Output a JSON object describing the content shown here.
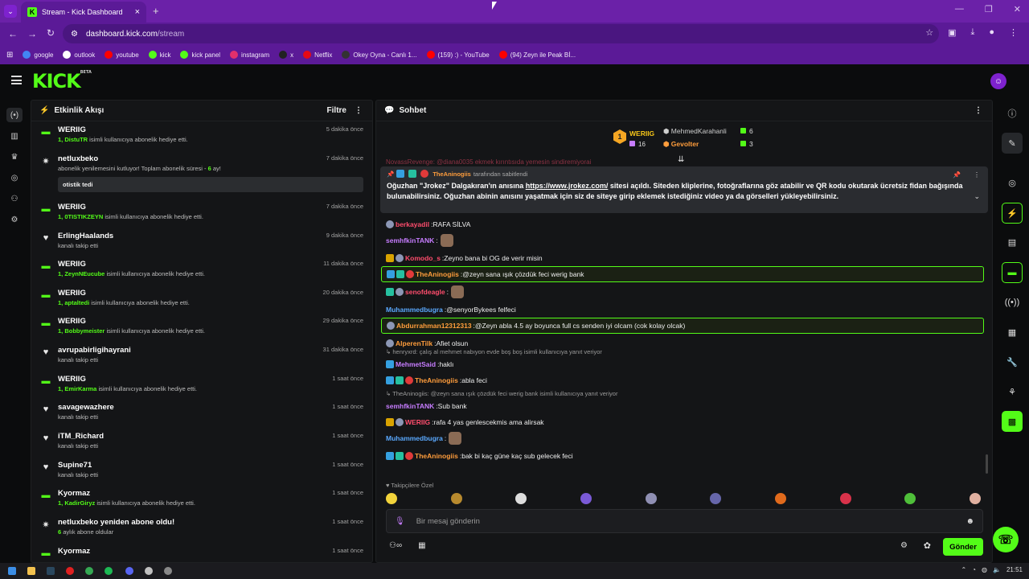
{
  "browser": {
    "tab_title": "Stream - Kick Dashboard",
    "url_host": "dashboard.kick.com",
    "url_path": "/stream",
    "bookmarks": [
      {
        "label": "google",
        "color": "#4285f4"
      },
      {
        "label": "outlook",
        "color": "#ffffff"
      },
      {
        "label": "youtube",
        "color": "#ff0000"
      },
      {
        "label": "kick",
        "color": "#53fc18"
      },
      {
        "label": "kick panel",
        "color": "#53fc18"
      },
      {
        "label": "instagram",
        "color": "#e1306c"
      },
      {
        "label": "x",
        "color": "#222222"
      },
      {
        "label": "Netflix",
        "color": "#e50914"
      },
      {
        "label": "Okey Oyna - Canlı 1...",
        "color": "#333333"
      },
      {
        "label": "(159) :) - YouTube",
        "color": "#ff0000"
      },
      {
        "label": "(94) Zeyn ile Peak Bİ...",
        "color": "#ff0000"
      }
    ]
  },
  "kick": {
    "logo": "KICK",
    "logo_sup": "BETA"
  },
  "activity": {
    "title": "Etkinlik Akışı",
    "filter_label": "Filtre",
    "items": [
      {
        "icon": "gift",
        "name": "WERIIG",
        "time": "5 dakika önce",
        "hl": "1, DistuTR",
        "rest": " isimli kullanıcıya abonelik hediye etti."
      },
      {
        "icon": "star",
        "name": "netluxbeko",
        "time": "7 dakika önce",
        "hl": "",
        "rest": "abonelik yenilemesini kutluyor! Toplam abonelik süresi - ",
        "hl2": "6",
        "rest2": " ay!",
        "quote": "otistik tedi"
      },
      {
        "icon": "gift",
        "name": "WERIIG",
        "time": "7 dakika önce",
        "hl": "1, 0TISTIKZEYN",
        "rest": " isimli kullanıcıya abonelik hediye etti."
      },
      {
        "icon": "heart",
        "name": "ErlingHaalands",
        "time": "9 dakika önce",
        "hl": "",
        "rest": "kanalı takip etti"
      },
      {
        "icon": "gift",
        "name": "WERIIG",
        "time": "11 dakika önce",
        "hl": "1, ZeynNEucube",
        "rest": " isimli kullanıcıya abonelik hediye etti."
      },
      {
        "icon": "gift",
        "name": "WERIIG",
        "time": "20 dakika önce",
        "hl": "1, aptaltedi",
        "rest": " isimli kullanıcıya abonelik hediye etti."
      },
      {
        "icon": "gift",
        "name": "WERIIG",
        "time": "29 dakika önce",
        "hl": "1, Bobbymeister",
        "rest": " isimli kullanıcıya abonelik hediye etti."
      },
      {
        "icon": "heart",
        "name": "avrupabirligihayrani",
        "time": "31 dakika önce",
        "hl": "",
        "rest": "kanalı takip etti"
      },
      {
        "icon": "gift",
        "name": "WERIIG",
        "time": "1 saat önce",
        "hl": "1, EmirKarma",
        "rest": " isimli kullanıcıya abonelik hediye etti."
      },
      {
        "icon": "heart",
        "name": "savagewazhere",
        "time": "1 saat önce",
        "hl": "",
        "rest": "kanalı takip etti"
      },
      {
        "icon": "heart",
        "name": "iTM_Richard",
        "time": "1 saat önce",
        "hl": "",
        "rest": "kanalı takip etti"
      },
      {
        "icon": "heart",
        "name": "Supine71",
        "time": "1 saat önce",
        "hl": "",
        "rest": "kanalı takip etti"
      },
      {
        "icon": "gift",
        "name": "Kyormaz",
        "time": "1 saat önce",
        "hl": "1, KadirGiryz",
        "rest": " isimli kullanıcıya abonelik hediye etti."
      },
      {
        "icon": "star",
        "name": "netluxbeko yeniden abone oldu!",
        "time": "1 saat önce",
        "hl": "6",
        "rest": " aylık abone oldular"
      },
      {
        "icon": "gift",
        "name": "Kyormaz",
        "time": "1 saat önce",
        "hl": "",
        "rest": ""
      }
    ]
  },
  "chat": {
    "title": "Sohbet",
    "top_gifter": {
      "badge": "1",
      "name": "WERIIG",
      "count": "16"
    },
    "leaders": [
      {
        "name": "MehmedKarahanli",
        "count": "6",
        "color": "#cfcfcf"
      },
      {
        "name": "Gevolter",
        "count": "3",
        "color": "#ff9d3c"
      }
    ],
    "pinned": {
      "by": "TheAninogiis",
      "suffix": "tarafından sabitlendi",
      "text_a": "Oğuzhan \"Jrokez\" Dalgakıran'ın anısına ",
      "link": "https://www.jrokez.com/",
      "text_b": " sitesi açıldı. Siteden kliplerine, fotoğraflarına göz atabilir ve QR kodu okutarak ücretsiz fidan bağışında bulunabilirsiniz. Oğuzhan abinin anısını yaşatmak için siz de siteye girip eklemek istediğiniz video ya da görselleri yükleyebilirsiniz."
    },
    "partial_msg": "NovassRevenge: @diana0035 ekmek kırıntısıda yemesin sindiremiyorai",
    "messages": [
      {
        "user": "berkayadil",
        "color": "#ff4d6d",
        "text": " RAFA SİLVA",
        "badges": [
          "gray"
        ],
        "hl": false
      },
      {
        "user": "semhfkinTANK",
        "color": "#c77dff",
        "text": " ",
        "badges": [],
        "hl": false,
        "emote": true
      },
      {
        "user": "Komodo_s",
        "color": "#ff4d6d",
        "text": " Zeyno bana bi OG de verir misin",
        "badges": [
          "gold",
          "gray"
        ],
        "hl": false
      },
      {
        "user": "TheAninogiis",
        "color": "#ff9d3c",
        "text": " @zeyn sana ışık çözdük feci werig bank",
        "badges": [
          "blue",
          "teal",
          "red"
        ],
        "hl": true
      },
      {
        "user": "senofdeagle",
        "color": "#ff4d6d",
        "text": " ",
        "badges": [
          "teal",
          "gray"
        ],
        "hl": false,
        "emote": true
      },
      {
        "user": "Muhammedbugra",
        "color": "#5aa9ff",
        "text": " @senyorBykees felfeci",
        "badges": [],
        "hl": false
      },
      {
        "user": "Abdurrahman12312313",
        "color": "#ff9d3c",
        "text": " @Zeyn abla 4.5 ay boyunca full cs senden iyi olcam (cok kolay olcak)",
        "badges": [
          "gray"
        ],
        "hl": true
      },
      {
        "user": "AlperenTilk",
        "color": "#ff9d3c",
        "text": " Afiet olsun",
        "badges": [
          "gray"
        ],
        "hl": false
      },
      {
        "user": "MehmetSaid",
        "color": "#c77dff",
        "text": " haklı",
        "badges": [
          "blue"
        ],
        "hl": false,
        "reply": "henryxrd: çalış al mehmet nabıyon evde boş boş isimli kullanıcıya yanıt veriyor"
      },
      {
        "user": "TheAninogiis",
        "color": "#ff9d3c",
        "text": " abla feci",
        "badges": [
          "blue",
          "teal",
          "red"
        ],
        "hl": false
      },
      {
        "user": "semhfkinTANK",
        "color": "#c77dff",
        "text": " Sub bank",
        "badges": [],
        "hl": false,
        "reply": "TheAninogiis: @zeyn sana ışık çözdük feci werig bank isimli kullanıcıya yanıt veriyor"
      },
      {
        "user": "WERIIG",
        "color": "#ff4d6d",
        "text": " rafa 4 yas genlescekmis ama alirsak",
        "badges": [
          "gold",
          "gray"
        ],
        "hl": false
      },
      {
        "user": "Muhammedbugra",
        "color": "#5aa9ff",
        "text": " ",
        "badges": [],
        "hl": false,
        "emote": true
      },
      {
        "user": "TheAninogiis",
        "color": "#ff9d3c",
        "text": " bak bi kaç güne kaç sub gelecek feci",
        "badges": [
          "blue",
          "teal",
          "red"
        ],
        "hl": false
      }
    ],
    "follower_only": "Takipçilere Özel",
    "input_placeholder": "Bir mesaj gönderin",
    "send_label": "Gönder"
  },
  "taskbar": {
    "time": "21:51"
  }
}
